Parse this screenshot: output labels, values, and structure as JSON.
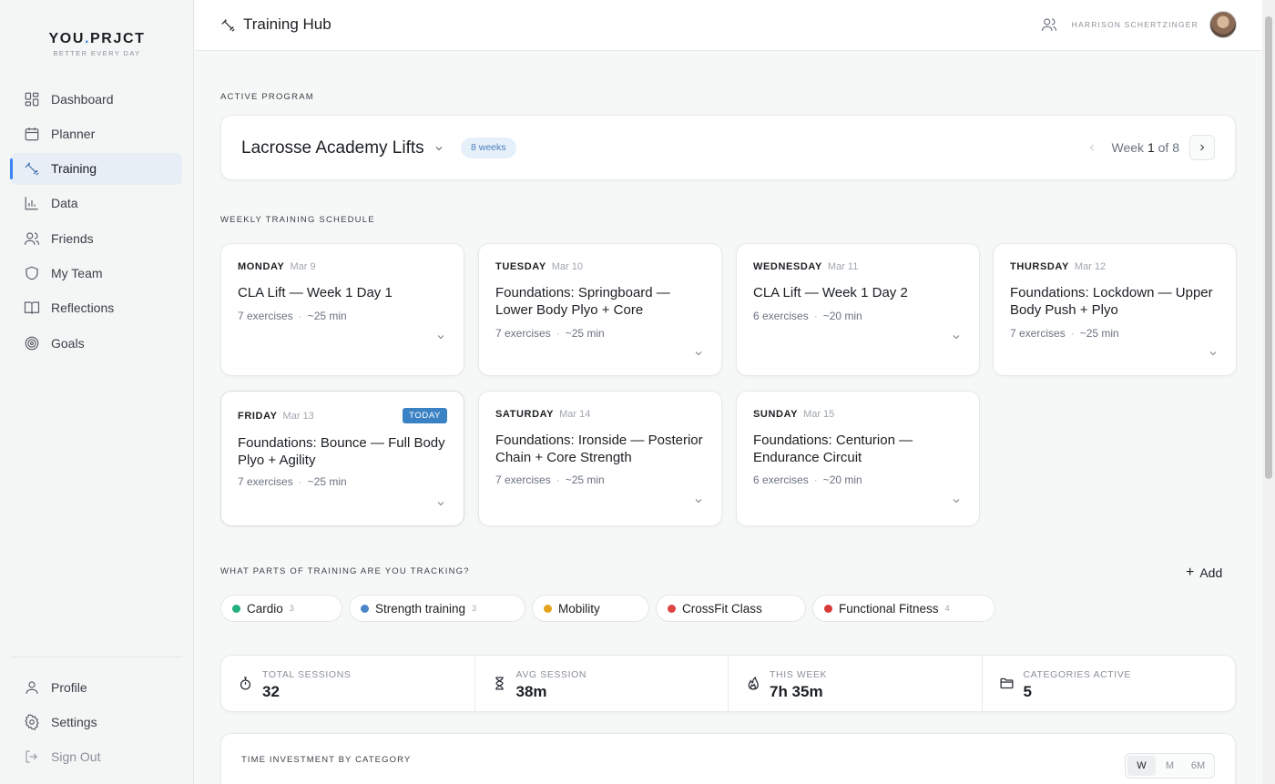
{
  "brand": {
    "name_part1": "YOU",
    "name_dot": ".",
    "name_part2": "PRJCT",
    "tagline": "BETTER EVERY DAY"
  },
  "nav": {
    "items": [
      {
        "label": "Dashboard",
        "icon": "grid-icon"
      },
      {
        "label": "Planner",
        "icon": "calendar-icon"
      },
      {
        "label": "Training",
        "icon": "dumbbell-icon",
        "active": true
      },
      {
        "label": "Data",
        "icon": "bar-chart-icon"
      },
      {
        "label": "Friends",
        "icon": "users-icon"
      },
      {
        "label": "My Team",
        "icon": "shield-icon"
      },
      {
        "label": "Reflections",
        "icon": "book-icon"
      },
      {
        "label": "Goals",
        "icon": "target-icon"
      }
    ],
    "bottom": [
      {
        "label": "Profile",
        "icon": "user-icon"
      },
      {
        "label": "Settings",
        "icon": "gear-icon"
      },
      {
        "label": "Sign Out",
        "icon": "sign-out-icon"
      }
    ]
  },
  "header": {
    "title": "Training Hub",
    "user_name": "HARRISON SCHERTZINGER"
  },
  "program": {
    "section_label": "ACTIVE PROGRAM",
    "name": "Lacrosse Academy Lifts",
    "duration_badge": "8 weeks",
    "week_prefix": "Week ",
    "week_current": "1",
    "week_suffix": " of 8"
  },
  "schedule": {
    "section_label": "WEEKLY TRAINING SCHEDULE",
    "days": [
      {
        "day": "MONDAY",
        "date": "Mar 9",
        "title": "CLA Lift — Week 1 Day 1",
        "exercises": "7 exercises",
        "duration": "~25 min"
      },
      {
        "day": "TUESDAY",
        "date": "Mar 10",
        "title": "Foundations: Springboard — Lower Body Plyo + Core",
        "exercises": "7 exercises",
        "duration": "~25 min"
      },
      {
        "day": "WEDNESDAY",
        "date": "Mar 11",
        "title": "CLA Lift — Week 1 Day 2",
        "exercises": "6 exercises",
        "duration": "~20 min"
      },
      {
        "day": "THURSDAY",
        "date": "Mar 12",
        "title": "Foundations: Lockdown — Upper Body Push + Plyo",
        "exercises": "7 exercises",
        "duration": "~25 min"
      },
      {
        "day": "FRIDAY",
        "date": "Mar 13",
        "title": "Foundations: Bounce — Full Body Plyo + Agility",
        "exercises": "7 exercises",
        "duration": "~25 min",
        "badge": "TODAY"
      },
      {
        "day": "SATURDAY",
        "date": "Mar 14",
        "title": "Foundations: Ironside — Posterior Chain + Core Strength",
        "exercises": "7 exercises",
        "duration": "~25 min"
      },
      {
        "day": "SUNDAY",
        "date": "Mar 15",
        "title": "Foundations: Centurion — Endurance Circuit",
        "exercises": "6 exercises",
        "duration": "~20 min"
      }
    ]
  },
  "tracking": {
    "section_label": "WHAT PARTS OF TRAINING ARE YOU TRACKING?",
    "add_label": "Add",
    "categories": [
      {
        "name": "Cardio",
        "count": "3",
        "color": "#22b07d"
      },
      {
        "name": "Strength training",
        "count": "3",
        "color": "#4a86c8"
      },
      {
        "name": "Mobility",
        "count": "",
        "color": "#e6a21c"
      },
      {
        "name": "CrossFit Class",
        "count": "",
        "color": "#dc4545"
      },
      {
        "name": "Functional Fitness",
        "count": "4",
        "color": "#d93b3b"
      }
    ]
  },
  "stats": [
    {
      "label": "TOTAL SESSIONS",
      "value": "32",
      "icon": "stopwatch-icon"
    },
    {
      "label": "AVG SESSION",
      "value": "38m",
      "icon": "hourglass-icon"
    },
    {
      "label": "THIS WEEK",
      "value": "7h 35m",
      "icon": "flame-icon"
    },
    {
      "label": "CATEGORIES ACTIVE",
      "value": "5",
      "icon": "folder-icon"
    }
  ],
  "investment": {
    "title": "TIME INVESTMENT BY CATEGORY",
    "ranges": [
      "W",
      "M",
      "6M"
    ],
    "active_range": "W"
  }
}
